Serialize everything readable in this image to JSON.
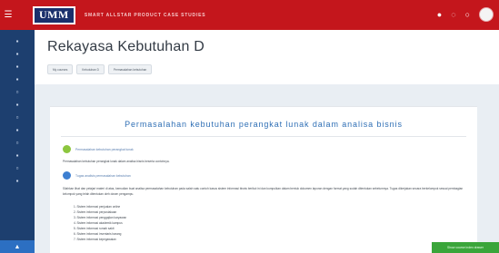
{
  "topbar": {
    "logo_text": "UMM",
    "site_title": "SMART ALLSTAR PRODUCT CASE STUDIES",
    "menu_icon": "hamburger-icon",
    "icons": [
      "bell-icon",
      "chat-icon",
      "settings-icon",
      "user-avatar"
    ]
  },
  "sidebar": {
    "icons": [
      "dashboard-icon",
      "home-icon",
      "calendar-icon",
      "files-icon",
      "courses-icon",
      "grades-icon",
      "users-icon",
      "badge-icon",
      "competency-icon",
      "folder-icon",
      "book-icon",
      "chart-icon"
    ],
    "bottom_icon": "chevron-up-icon"
  },
  "header": {
    "title": "Rekayasa Kebutuhan D",
    "breadcrumb": [
      "My courses",
      "Kebutuhan D",
      "Permasalahan kebutuhan"
    ]
  },
  "content": {
    "section_title": "Permasalahan kebutuhan perangkat lunak dalam analisa bisnis",
    "item1_link": "Permasalahan kebutuhan perangkat lunak",
    "item1_desc": "Permasalahan kebutuhan perangkat lunak dalam analisa bisnis beserta contohnya.",
    "item2_link": "Tugas analisis permasalahan kebutuhan",
    "paragraph": "Silahkan lihat dan pelajari materi di atas, kemudian buat analisa permasalahan kebutuhan pada salah satu contoh kasus sistem informasi bisnis berikut ini dan kumpulkan dalam bentuk dokumen laporan dengan format yang sudah ditentukan sebelumnya. Tugas dikerjakan secara berkelompok sesuai pembagian kelompok yang telah ditentukan oleh dosen pengampu.",
    "list": [
      "1. Sistem informasi penjualan online",
      "2. Sistem informasi perpustakaan",
      "3. Sistem informasi penggajian karyawan",
      "4. Sistem informasi akademik kampus",
      "5. Sistem informasi rumah sakit",
      "6. Sistem informasi inventaris barang",
      "7. Sistem informasi kepegawaian"
    ]
  },
  "toast": {
    "text": "Show course index drawer"
  },
  "colors": {
    "topbar": "#c4161c",
    "sidebar": "#1d3f6f",
    "heading": "#2f6fb5",
    "toast": "#3aa53a"
  }
}
